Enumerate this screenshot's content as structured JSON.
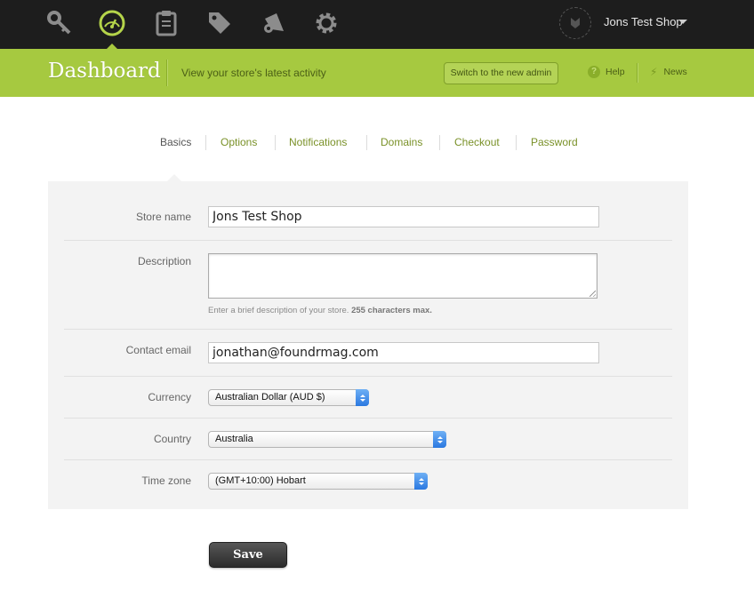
{
  "topbar": {
    "icons": [
      "key-icon",
      "speedometer-icon",
      "clipboard-icon",
      "tag-icon",
      "megaphone-icon",
      "gear-icon"
    ],
    "active_icon": "speedometer-icon",
    "shop_name": "Jons Test Shop"
  },
  "header": {
    "title": "Dashboard",
    "subtitle": "View your store's latest activity",
    "switch_label": "Switch to the new admin",
    "help_label": "Help",
    "news_label": "News"
  },
  "tabs": [
    {
      "label": "Basics",
      "active": true
    },
    {
      "label": "Options",
      "active": false
    },
    {
      "label": "Notifications",
      "active": false
    },
    {
      "label": "Domains",
      "active": false
    },
    {
      "label": "Checkout",
      "active": false
    },
    {
      "label": "Password",
      "active": false
    }
  ],
  "form": {
    "store_name_label": "Store name",
    "store_name_value": "Jons Test Shop",
    "description_label": "Description",
    "description_value": "",
    "description_hint": "Enter a brief description of your store.",
    "description_hint_bold": "255 characters max.",
    "contact_email_label": "Contact email",
    "contact_email_value": "jonathan@foundrmag.com",
    "currency_label": "Currency",
    "currency_value": "Australian Dollar (AUD $)",
    "country_label": "Country",
    "country_value": "Australia",
    "timezone_label": "Time zone",
    "timezone_value": "(GMT+10:00) Hobart"
  },
  "save_label": "Save",
  "colors": {
    "topbar": "#1d1d1d",
    "accent_green": "#a6c940",
    "tab_link": "#7a9128",
    "panel": "#f3f3f3"
  }
}
